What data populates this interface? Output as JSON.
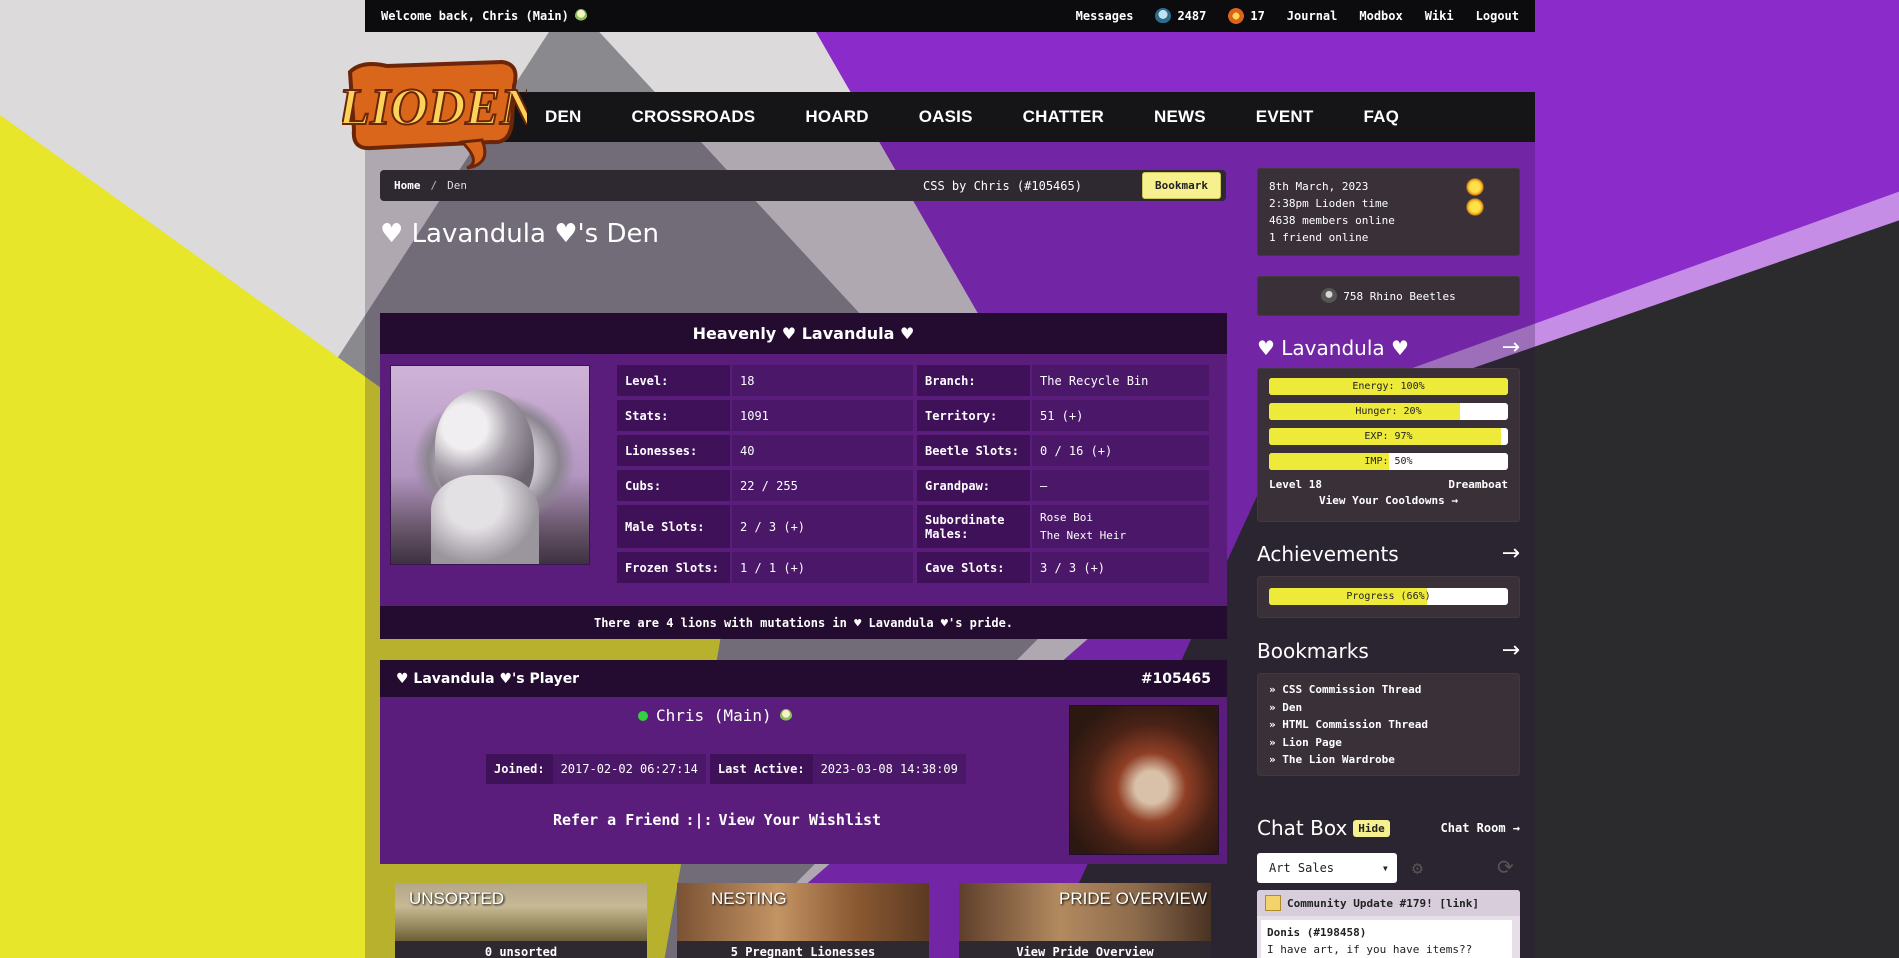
{
  "topbar": {
    "welcome": "Welcome back, Chris (Main)",
    "messages": "Messages",
    "beetles_count": "2487",
    "gifts_count": "17",
    "journal": "Journal",
    "modbox": "Modbox",
    "wiki": "Wiki",
    "logout": "Logout"
  },
  "nav": {
    "logo_text": "LIODEN",
    "items": [
      "DEN",
      "CROSSROADS",
      "HOARD",
      "OASIS",
      "CHATTER",
      "NEWS",
      "EVENT",
      "FAQ"
    ]
  },
  "breadcrumb": {
    "home": "Home",
    "separator": "/",
    "current": "Den",
    "css_credit": "CSS by Chris (#105465)",
    "bookmark_label": "Bookmark"
  },
  "den_title": "♥ Lavandula ♥'s Den",
  "lion": {
    "name": "Heavenly ♥ Lavandula ♥",
    "stats_left": [
      {
        "k": "Level:",
        "v": "18"
      },
      {
        "k": "Stats:",
        "v": "1091"
      },
      {
        "k": "Lionesses:",
        "v": "40"
      },
      {
        "k": "Cubs:",
        "v": "22 / 255"
      },
      {
        "k": "Male Slots:",
        "v": "2 / 3 (+)"
      },
      {
        "k": "Frozen Slots:",
        "v": "1 / 1 (+)"
      }
    ],
    "stats_right": [
      {
        "k": "Branch:",
        "v": "The Recycle Bin"
      },
      {
        "k": "Territory:",
        "v": "51 (+)"
      },
      {
        "k": "Beetle Slots:",
        "v": "0 / 16 (+)"
      },
      {
        "k": "Grandpaw:",
        "v": "–"
      },
      {
        "k": "Subordinate Males:",
        "v1": "Rose Boi",
        "v2": "The Next Heir"
      },
      {
        "k": "Cave Slots:",
        "v": "3 / 3 (+)"
      }
    ],
    "mutation_note": "There are 4 lions with mutations in ♥ Lavandula ♥'s pride."
  },
  "player": {
    "header": "♥ Lavandula ♥'s Player",
    "id": "#105465",
    "name": "Chris (Main)",
    "joined_label": "Joined:",
    "joined": "2017-02-02 06:27:14",
    "active_label": "Last Active:",
    "active": "2023-03-08 14:38:09",
    "refer": "Refer a Friend",
    "link_sep": ":|:",
    "wishlist": "View Your Wishlist"
  },
  "cards": [
    {
      "title": "UNSORTED",
      "sub": "0 unsorted"
    },
    {
      "title": "NESTING",
      "sub": "5 Pregnant Lionesses"
    },
    {
      "title": "PRIDE OVERVIEW",
      "sub": "View Pride Overview"
    }
  ],
  "sidebar": {
    "date": "8th March, 2023",
    "time": "2:38pm Lioden time",
    "members": "4638 members online",
    "friends": "1 friend online",
    "rhino": "758 Rhino Beetles",
    "lion_name": "♥ Lavandula ♥",
    "arrow": "→",
    "bars": [
      {
        "label": "Energy: 100%",
        "value": 1.0
      },
      {
        "label": "Hunger: 20%",
        "value": 0.8
      },
      {
        "label": "EXP: 97%",
        "value": 0.97
      },
      {
        "label": "IMP: 50%",
        "value": 0.5
      }
    ],
    "level": "Level 18",
    "title": "Dreamboat",
    "cooldowns": "View Your Cooldowns →",
    "achievements": "Achievements",
    "achievement_bar": {
      "label": "Progress (66%)",
      "value": 0.66
    },
    "bookmarks_title": "Bookmarks",
    "bookmarks": [
      "» CSS Commission Thread",
      "» Den",
      "» HTML Commission Thread",
      "» Lion Page",
      "» The Lion Wardrobe"
    ],
    "chat_title": "Chat Box",
    "hide": "Hide",
    "chat_room": "Chat Room →",
    "chat_select": "Art Sales",
    "announce": "Community Update #179! [link]",
    "chat_user": "Donis (#198458)",
    "chat_msg": "I have art, if you have items?? [link]"
  },
  "colors": {
    "accent_yellow": "#f7f08e",
    "panel_purple": "#5a1d7c",
    "panel_dark": "#230c2f",
    "sidebar_box": "#3a3138"
  }
}
